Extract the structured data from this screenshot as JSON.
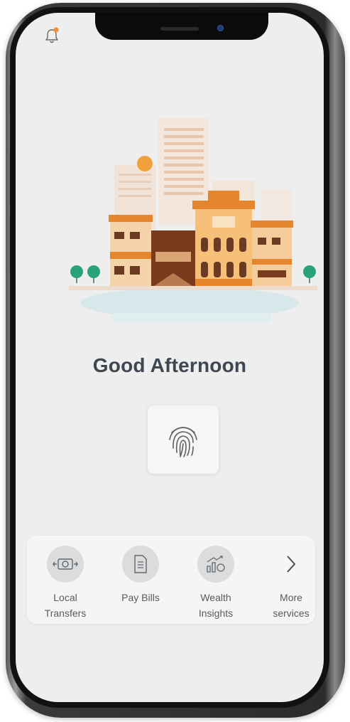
{
  "screen": {
    "greeting": "Good Afternoon"
  },
  "icons": {
    "notification": "bell-icon",
    "fingerprint": "fingerprint-icon"
  },
  "quick_actions": [
    {
      "label": "Local\nTransfers",
      "icon": "money-transfer-icon"
    },
    {
      "label": "Pay Bills",
      "icon": "bill-document-icon"
    },
    {
      "label": "Wealth\nInsights",
      "icon": "growth-chart-icon"
    },
    {
      "label": "More\nservices",
      "icon": "chevron-right-icon"
    }
  ],
  "colors": {
    "accent_orange": "#f2a23a",
    "notification_dot": "#f0913a",
    "tree_green": "#2aa37a",
    "screen_bg": "#eeeeee"
  }
}
